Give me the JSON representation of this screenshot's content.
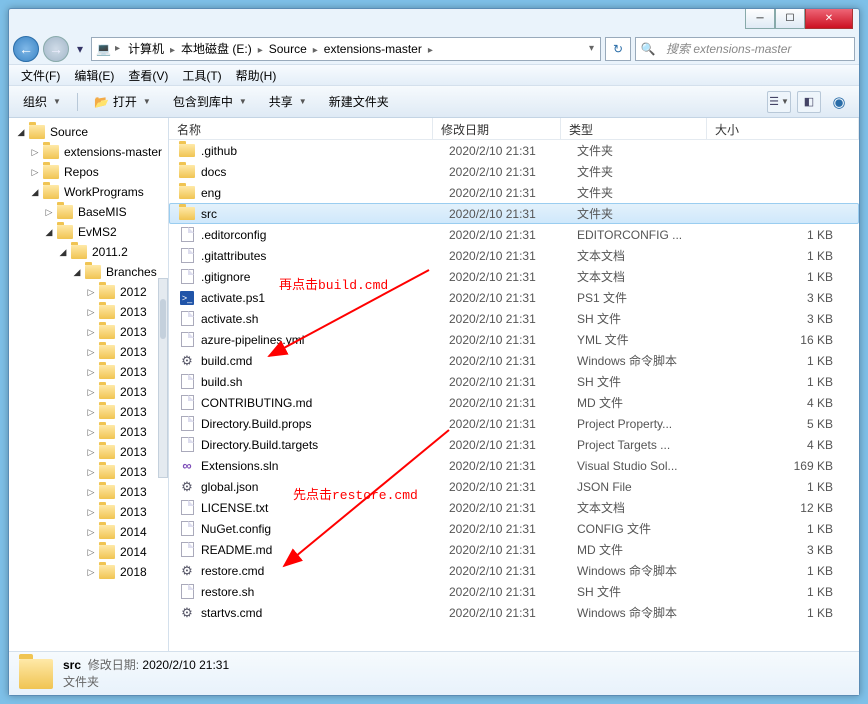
{
  "titlebar": {
    "min": "─",
    "max": "☐",
    "close": "✕"
  },
  "nav": {
    "back": "←",
    "fwd": "→",
    "dropdown": "▾",
    "refresh": "↻"
  },
  "breadcrumb": {
    "icon": "💻",
    "items": [
      "计算机",
      "本地磁盘 (E:)",
      "Source",
      "extensions-master"
    ]
  },
  "search": {
    "placeholder": "搜索 extensions-master",
    "icon": "🔍"
  },
  "menu": {
    "file": "文件(F)",
    "edit": "编辑(E)",
    "view": "查看(V)",
    "tools": "工具(T)",
    "help": "帮助(H)"
  },
  "toolbar": {
    "organize": "组织",
    "open": "打开",
    "include": "包含到库中",
    "share": "共享",
    "new_folder": "新建文件夹"
  },
  "tree": [
    {
      "lvl": 0,
      "arr": "open",
      "label": "Source"
    },
    {
      "lvl": 1,
      "arr": "closed",
      "label": "extensions-master"
    },
    {
      "lvl": 1,
      "arr": "closed",
      "label": "Repos"
    },
    {
      "lvl": 1,
      "arr": "open",
      "label": "WorkPrograms"
    },
    {
      "lvl": 2,
      "arr": "closed",
      "label": "BaseMIS"
    },
    {
      "lvl": 2,
      "arr": "open",
      "label": "EvMS2"
    },
    {
      "lvl": 3,
      "arr": "open",
      "label": "2011.2"
    },
    {
      "lvl": 4,
      "arr": "open",
      "label": "Branches"
    },
    {
      "lvl": 5,
      "arr": "closed",
      "label": "2012"
    },
    {
      "lvl": 5,
      "arr": "closed",
      "label": "2013"
    },
    {
      "lvl": 5,
      "arr": "closed",
      "label": "2013"
    },
    {
      "lvl": 5,
      "arr": "closed",
      "label": "2013"
    },
    {
      "lvl": 5,
      "arr": "closed",
      "label": "2013"
    },
    {
      "lvl": 5,
      "arr": "closed",
      "label": "2013"
    },
    {
      "lvl": 5,
      "arr": "closed",
      "label": "2013"
    },
    {
      "lvl": 5,
      "arr": "closed",
      "label": "2013"
    },
    {
      "lvl": 5,
      "arr": "closed",
      "label": "2013"
    },
    {
      "lvl": 5,
      "arr": "closed",
      "label": "2013"
    },
    {
      "lvl": 5,
      "arr": "closed",
      "label": "2013"
    },
    {
      "lvl": 5,
      "arr": "closed",
      "label": "2013"
    },
    {
      "lvl": 5,
      "arr": "closed",
      "label": "2014"
    },
    {
      "lvl": 5,
      "arr": "closed",
      "label": "2014"
    },
    {
      "lvl": 5,
      "arr": "closed",
      "label": "2018"
    }
  ],
  "columns": {
    "name": "名称",
    "date": "修改日期",
    "type": "类型",
    "size": "大小"
  },
  "files": [
    {
      "ic": "fold",
      "name": ".github",
      "date": "2020/2/10 21:31",
      "type": "文件夹",
      "size": ""
    },
    {
      "ic": "fold",
      "name": "docs",
      "date": "2020/2/10 21:31",
      "type": "文件夹",
      "size": ""
    },
    {
      "ic": "fold",
      "name": "eng",
      "date": "2020/2/10 21:31",
      "type": "文件夹",
      "size": ""
    },
    {
      "ic": "fold",
      "name": "src",
      "date": "2020/2/10 21:31",
      "type": "文件夹",
      "size": "",
      "sel": true
    },
    {
      "ic": "file",
      "name": ".editorconfig",
      "date": "2020/2/10 21:31",
      "type": "EDITORCONFIG ...",
      "size": "1 KB"
    },
    {
      "ic": "file",
      "name": ".gitattributes",
      "date": "2020/2/10 21:31",
      "type": "文本文档",
      "size": "1 KB"
    },
    {
      "ic": "file",
      "name": ".gitignore",
      "date": "2020/2/10 21:31",
      "type": "文本文档",
      "size": "1 KB"
    },
    {
      "ic": "ps1",
      "name": "activate.ps1",
      "date": "2020/2/10 21:31",
      "type": "PS1 文件",
      "size": "3 KB"
    },
    {
      "ic": "file",
      "name": "activate.sh",
      "date": "2020/2/10 21:31",
      "type": "SH 文件",
      "size": "3 KB"
    },
    {
      "ic": "file",
      "name": "azure-pipelines.yml",
      "date": "2020/2/10 21:31",
      "type": "YML 文件",
      "size": "16 KB"
    },
    {
      "ic": "gear",
      "name": "build.cmd",
      "date": "2020/2/10 21:31",
      "type": "Windows 命令脚本",
      "size": "1 KB"
    },
    {
      "ic": "file",
      "name": "build.sh",
      "date": "2020/2/10 21:31",
      "type": "SH 文件",
      "size": "1 KB"
    },
    {
      "ic": "file",
      "name": "CONTRIBUTING.md",
      "date": "2020/2/10 21:31",
      "type": "MD 文件",
      "size": "4 KB"
    },
    {
      "ic": "file",
      "name": "Directory.Build.props",
      "date": "2020/2/10 21:31",
      "type": "Project Property...",
      "size": "5 KB"
    },
    {
      "ic": "file",
      "name": "Directory.Build.targets",
      "date": "2020/2/10 21:31",
      "type": "Project Targets ...",
      "size": "4 KB"
    },
    {
      "ic": "sln",
      "name": "Extensions.sln",
      "date": "2020/2/10 21:31",
      "type": "Visual Studio Sol...",
      "size": "169 KB"
    },
    {
      "ic": "gear",
      "name": "global.json",
      "date": "2020/2/10 21:31",
      "type": "JSON File",
      "size": "1 KB"
    },
    {
      "ic": "file",
      "name": "LICENSE.txt",
      "date": "2020/2/10 21:31",
      "type": "文本文档",
      "size": "12 KB"
    },
    {
      "ic": "file",
      "name": "NuGet.config",
      "date": "2020/2/10 21:31",
      "type": "CONFIG 文件",
      "size": "1 KB"
    },
    {
      "ic": "file",
      "name": "README.md",
      "date": "2020/2/10 21:31",
      "type": "MD 文件",
      "size": "3 KB"
    },
    {
      "ic": "gear",
      "name": "restore.cmd",
      "date": "2020/2/10 21:31",
      "type": "Windows 命令脚本",
      "size": "1 KB"
    },
    {
      "ic": "file",
      "name": "restore.sh",
      "date": "2020/2/10 21:31",
      "type": "SH 文件",
      "size": "1 KB"
    },
    {
      "ic": "gear",
      "name": "startvs.cmd",
      "date": "2020/2/10 21:31",
      "type": "Windows 命令脚本",
      "size": "1 KB"
    }
  ],
  "annot": {
    "a1": "再点击build.cmd",
    "a2": "先点击restore.cmd"
  },
  "status": {
    "name": "src",
    "date_lbl": "修改日期:",
    "date": "2020/2/10 21:31",
    "type": "文件夹"
  }
}
